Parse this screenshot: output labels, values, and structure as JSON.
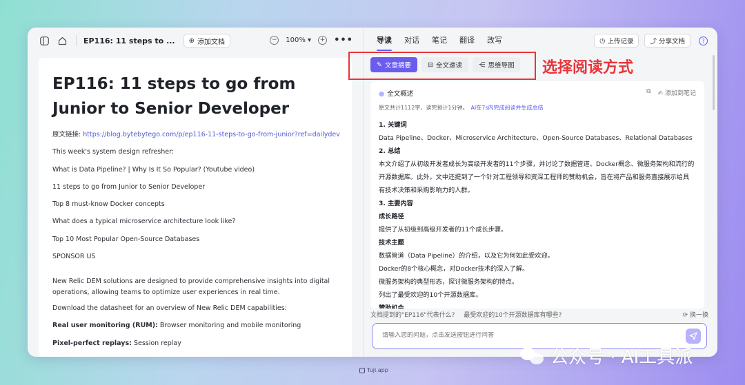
{
  "left": {
    "doc_title": "EP116: 11 steps to ...",
    "add_doc_label": "添加文档",
    "zoom_level": "100%",
    "doc": {
      "heading": "EP116: 11 steps to go from Junior to Senior Developer",
      "source_label": "原文链接:",
      "source_url": "https://blog.bytebytego.com/p/ep116-11-steps-to-go-from-junior?ref=dailydev",
      "lines": [
        "This week's system design refresher:",
        "What is Data Pipeline? | Why Is It So Popular? (Youtube video)",
        "11 steps to go from Junior to Senior Developer",
        "Top 8 must-know Docker concepts",
        "What does a typical microservice architecture look like?",
        "Top 10 Most Popular Open-Source Databases",
        "SPONSOR US"
      ],
      "para1": "New Relic DEM solutions are designed to provide comprehensive insights into digital operations, allowing teams to optimize user experiences in real time.",
      "para2": "Download the datasheet for an overview of New Relic DEM capabilities:",
      "feature1_bold": "Real user monitoring (RUM):",
      "feature1_text": " Browser monitoring and mobile monitoring",
      "feature2_bold": "Pixel-perfect replays:",
      "feature2_text": " Session replay"
    }
  },
  "right": {
    "tabs": [
      "导读",
      "对话",
      "笔记",
      "翻译",
      "改写"
    ],
    "upload_record": "上传记录",
    "share_doc": "分享文档",
    "help": "?",
    "modes": [
      "文章摘要",
      "全文速读",
      "思维导图"
    ],
    "card": {
      "title": "全文概述",
      "add_note": "添加到笔记",
      "meta": "原文共计1112字，读完预计1分钟。",
      "meta_ai": "AI在7s内完成阅读并生成总结",
      "sections": [
        {
          "h": "1. 关键词"
        },
        {
          "p": "Data Pipeline、Docker、Microservice Architecture、Open-Source Databases、Relational Databases"
        },
        {
          "h": "2. 总结"
        },
        {
          "p": "本文介绍了从初级开发者成长为高级开发者的11个步骤，并讨论了数据管道、Docker概念、微服务架构和流行的"
        },
        {
          "p": "开源数据库。此外，文中还提到了一个针对工程领导和资深工程师的赞助机会，旨在将产品和服务直接展示给具"
        },
        {
          "p": "有技术决策和采购影响力的人群。"
        },
        {
          "h": "3. 主要内容"
        },
        {
          "h": "成长路径"
        },
        {
          "p": "提供了从初级到高级开发者的11个成长步骤。"
        },
        {
          "h": "技术主题"
        },
        {
          "p": "数据管道（Data Pipeline）的介绍，以及它为何如此受欢迎。"
        },
        {
          "p": "Docker的8个核心概念，对Docker技术的深入了解。"
        },
        {
          "p": "微服务架构的典型形态，探讨微服务架构的特点。"
        },
        {
          "p": "列出了最受欢迎的10个开源数据库。"
        },
        {
          "h": "赞助机会"
        }
      ]
    },
    "suggest_q1": "文档提到的\"EP116\"代表什么?",
    "suggest_q2": "最受欢迎的10个开源数据库有哪些?",
    "refresh_label": "换一换",
    "input_placeholder": "请输入您的问题，点击发送按钮进行问答"
  },
  "annotation_text": "选择阅读方式",
  "footer_label": "Tuji.app",
  "watermark_text": "公众号 · AI工具派",
  "colors": {
    "accent": "#6b5cf0",
    "annotation": "#e8343a"
  }
}
